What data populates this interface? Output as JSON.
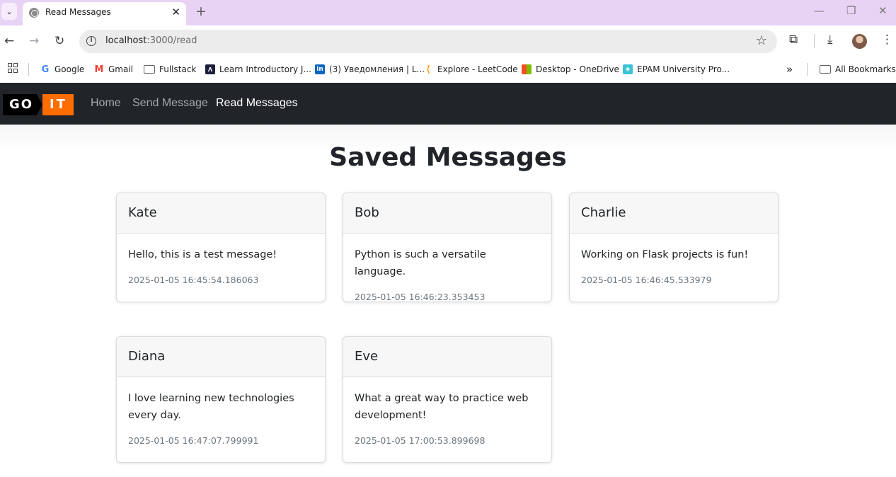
{
  "browser": {
    "tab_title": "Read Messages",
    "url_host": "localhost",
    "url_rest": ":3000/read",
    "bookmarks": [
      {
        "label": "Google",
        "icon": "google-icon",
        "color": "#4285f4"
      },
      {
        "label": "Gmail",
        "icon": "gmail-icon",
        "color": "#ea4335"
      },
      {
        "label": "Fullstack",
        "icon": "folder-icon",
        "color": "#5f6368"
      },
      {
        "label": "Learn Introductory J...",
        "icon": "learn-icon",
        "color": "#1b1f3b"
      },
      {
        "label": "(3) Уведомления | L...",
        "icon": "linkedin-icon",
        "color": "#0a66c2"
      },
      {
        "label": "Explore - LeetCode",
        "icon": "leetcode-icon",
        "color": "#ffa116"
      },
      {
        "label": "Desktop - OneDrive",
        "icon": "microsoft-icon",
        "color": "#00a4ef"
      },
      {
        "label": "EPAM University Pro...",
        "icon": "epam-icon",
        "color": "#39c2d7"
      }
    ],
    "all_bookmarks": "All Bookmarks"
  },
  "site": {
    "logo_left": "GO",
    "logo_right": "IT",
    "nav": {
      "home": "Home",
      "send": "Send Message",
      "read": "Read Messages"
    },
    "page_title": "Saved Messages",
    "messages": [
      {
        "name": "Kate",
        "text": "Hello, this is a test message!",
        "time": "2025-01-05 16:45:54.186063"
      },
      {
        "name": "Bob",
        "text": "Python is such a versatile language.",
        "time": "2025-01-05 16:46:23.353453"
      },
      {
        "name": "Charlie",
        "text": "Working on Flask projects is fun!",
        "time": "2025-01-05 16:46:45.533979"
      },
      {
        "name": "Diana",
        "text": "I love learning new technologies every day.",
        "time": "2025-01-05 16:47:07.799991"
      },
      {
        "name": "Eve",
        "text": "What a great way to practice web development!",
        "time": "2025-01-05 17:00:53.899698"
      }
    ]
  },
  "colors": {
    "navbar_bg": "#212529",
    "logo_orange": "#ff6c00",
    "tabstrip_bg": "#e9d3f5",
    "muted_text": "#6c757d"
  }
}
